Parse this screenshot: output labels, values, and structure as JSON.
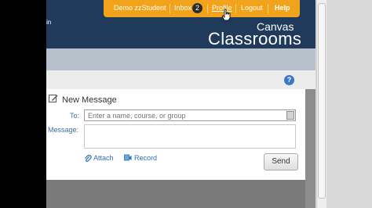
{
  "header": {
    "left_text": "in",
    "brand_line1": "Canvas",
    "brand_line2": "Classrooms"
  },
  "topbar": {
    "user": "Demo zzStudent",
    "inbox_label": "Inbox",
    "inbox_count": "2",
    "profile": "Profile",
    "logout": "Logout",
    "help": "Help"
  },
  "compose": {
    "title": "New Message",
    "to_label": "To:",
    "to_placeholder": "Enter a name, course, or group",
    "message_label": "Message:",
    "attach_label": "Attach",
    "record_label": "Record",
    "send_label": "Send"
  },
  "icons": {
    "help": "help-icon",
    "compose": "pencil-icon",
    "attach": "paperclip-icon",
    "record": "media-icon",
    "address_book": "address-book-icon"
  },
  "colors": {
    "header": "#1f3a5b",
    "topbar": "#f0a31b",
    "link": "#2d6eb6"
  }
}
